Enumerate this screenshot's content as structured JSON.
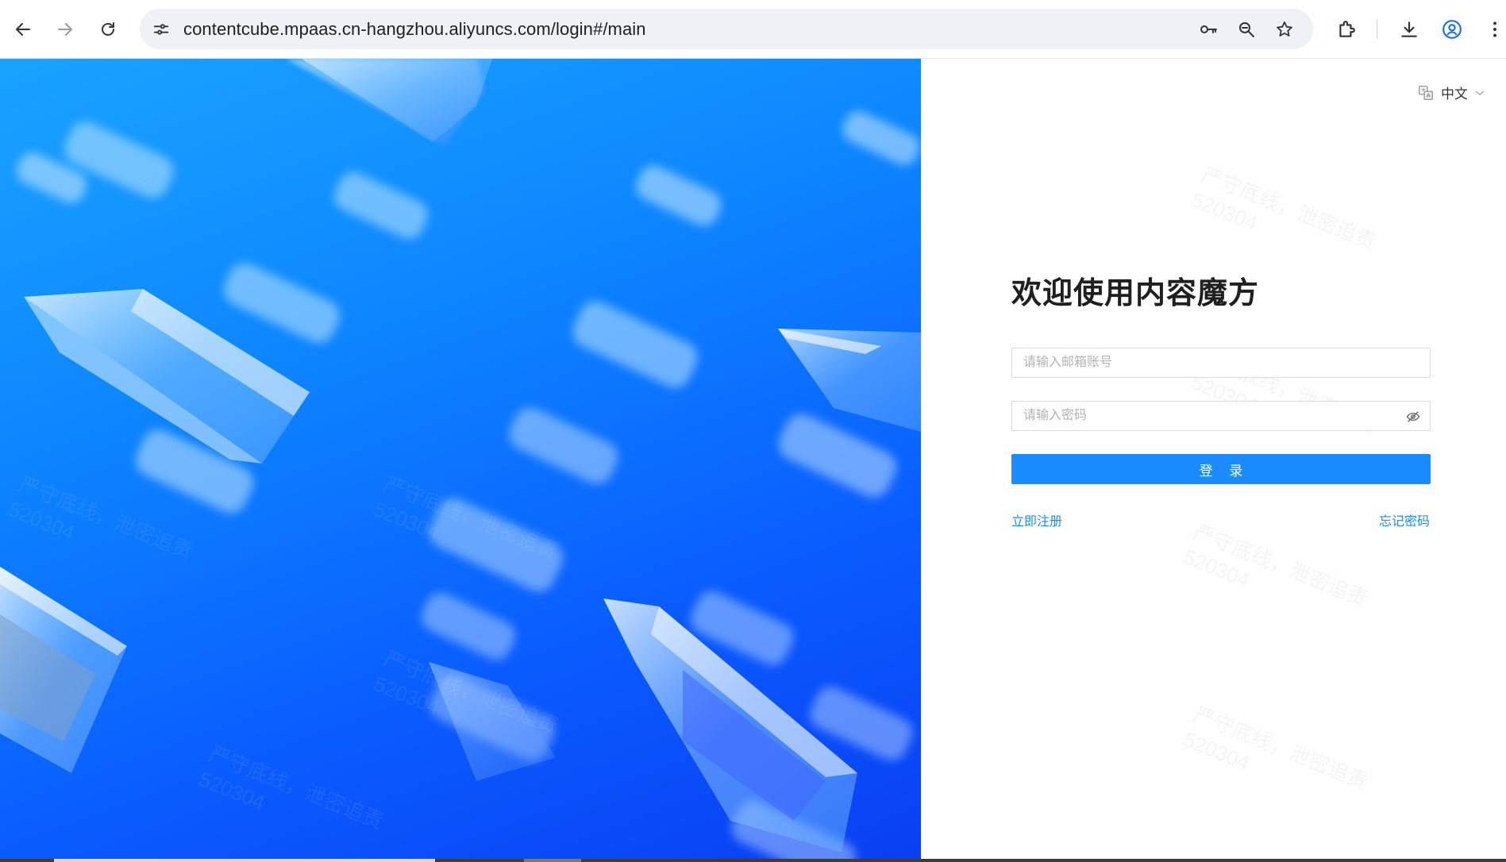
{
  "browser": {
    "url": "contentcube.mpaas.cn-hangzhou.aliyuncs.com/login#/main",
    "icons": [
      "back-arrow-icon",
      "forward-arrow-icon",
      "reload-icon",
      "site-info-icon",
      "password-key-icon",
      "zoom-icon",
      "bookmark-star-icon",
      "extensions-icon",
      "download-icon",
      "profile-icon",
      "menu-kebab-icon"
    ]
  },
  "language": {
    "label": "中文",
    "icon": "translate-icon"
  },
  "login": {
    "title": "欢迎使用内容魔方",
    "email_placeholder": "请输入邮箱账号",
    "password_placeholder": "请输入密码",
    "submit_label": "登 录",
    "register_label": "立即注册",
    "forgot_label": "忘记密码"
  },
  "watermark": {
    "line1": "严守底线，泄密追责",
    "line2": "520304"
  },
  "colors": {
    "primary": "#1a8cff",
    "hero_top": "#1aa3ff",
    "hero_bottom": "#0a3ff2"
  }
}
